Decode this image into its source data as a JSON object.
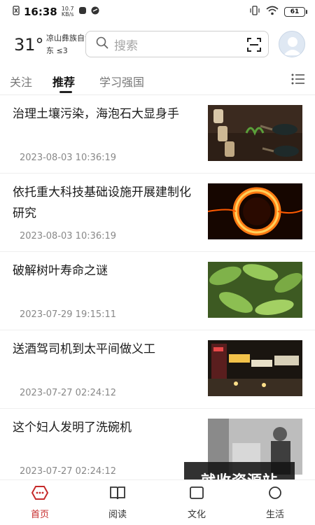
{
  "status_bar": {
    "time": "16:38",
    "net_speed_value": "10.7",
    "net_speed_unit": "KB/s",
    "battery": "61"
  },
  "header": {
    "temperature": "31°",
    "location": "凉山彝族自治州",
    "wind": "东 ≤3",
    "search_placeholder": "搜索"
  },
  "tabs": [
    {
      "label": "关注"
    },
    {
      "label": "推荐"
    },
    {
      "label": "学习强国"
    }
  ],
  "feed": [
    {
      "title": "治理土壤污染，海泡石大显身手",
      "date": "2023-08-03 10:36:19",
      "thumb": "soil-gardening-image"
    },
    {
      "title": "依托重大科技基础设施开展建制化研究",
      "date": "2023-08-03 10:36:19",
      "thumb": "fire-ring-image"
    },
    {
      "title": "破解树叶寿命之谜",
      "date": "2023-07-29 19:15:11",
      "thumb": "green-leaves-image"
    },
    {
      "title": "送酒驾司机到太平间做义工",
      "date": "2023-07-27 02:24:12",
      "thumb": "night-street-image"
    },
    {
      "title": "这个妇人发明了洗碗机",
      "date": "2023-07-27 02:24:12",
      "thumb": "vintage-photo-image"
    }
  ],
  "bottom_nav": [
    {
      "label": "首页",
      "icon": "home-icon"
    },
    {
      "label": "阅读",
      "icon": "book-icon"
    },
    {
      "label": "文化",
      "icon": "culture-icon"
    },
    {
      "label": "生活",
      "icon": "life-icon"
    }
  ],
  "watermark": "就收资源站",
  "colors": {
    "accent": "#c62a2a",
    "text": "#1b1b1b",
    "muted": "#888888"
  }
}
